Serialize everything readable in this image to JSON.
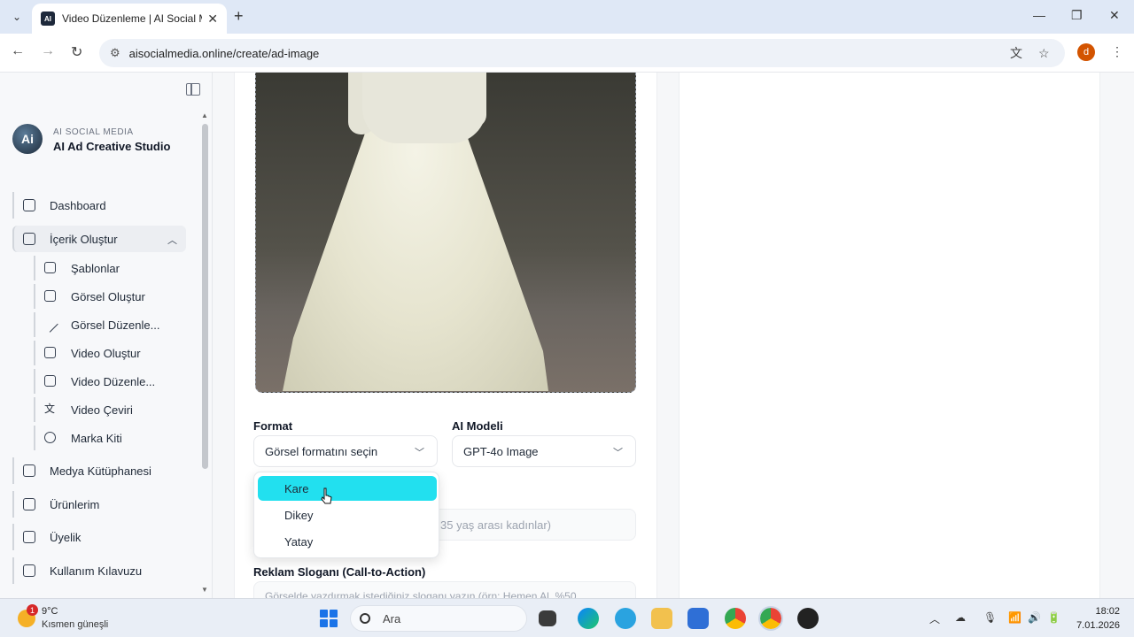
{
  "browser": {
    "tab_title": "Video Düzenleme | AI Social Me",
    "tab_favicon_text": "AI",
    "new_tab": "+",
    "url": "aisocialmedia.online/create/ad-image",
    "profile_initial": "d"
  },
  "sidebar": {
    "brand_small": "AI SOCIAL MEDIA",
    "brand_title": "AI Ad Creative Studio",
    "logo_text": "Ai",
    "items": [
      {
        "label": "Dashboard"
      },
      {
        "label": "İçerik Oluştur"
      },
      {
        "label": "Medya Kütüphanesi"
      },
      {
        "label": "Ürünlerim"
      },
      {
        "label": "Üyelik"
      },
      {
        "label": "Kullanım Kılavuzu"
      }
    ],
    "subitems": [
      {
        "label": "Şablonlar"
      },
      {
        "label": "Görsel Oluştur"
      },
      {
        "label": "Görsel Düzenle..."
      },
      {
        "label": "Video Oluştur"
      },
      {
        "label": "Video Düzenle..."
      },
      {
        "label": "Video Çeviri"
      },
      {
        "label": "Marka Kiti"
      }
    ]
  },
  "form": {
    "format_label": "Format",
    "format_placeholder": "Görsel formatını seçin",
    "model_label": "AI Modeli",
    "model_value": "GPT-4o Image",
    "audience_placeholder_visible": "35 yaş arası kadınlar)",
    "cta_label": "Reklam Sloganı (Call-to-Action)",
    "cta_placeholder": "Görselde yazdırmak istediğiniz sloganı yazın (örn: Hemen Al, %50"
  },
  "dropdown": {
    "options": [
      {
        "label": "Kare",
        "selected": true
      },
      {
        "label": "Dikey",
        "selected": false
      },
      {
        "label": "Yatay",
        "selected": false
      }
    ]
  },
  "taskbar": {
    "weather_temp": "9°C",
    "weather_desc": "Kısmen güneşli",
    "weather_badge": "1",
    "search_label": "Ara",
    "time": "18:02",
    "date": "7.01.2026"
  },
  "colors": {
    "selected_option": "#22e0ef",
    "profile": "#d35400"
  }
}
